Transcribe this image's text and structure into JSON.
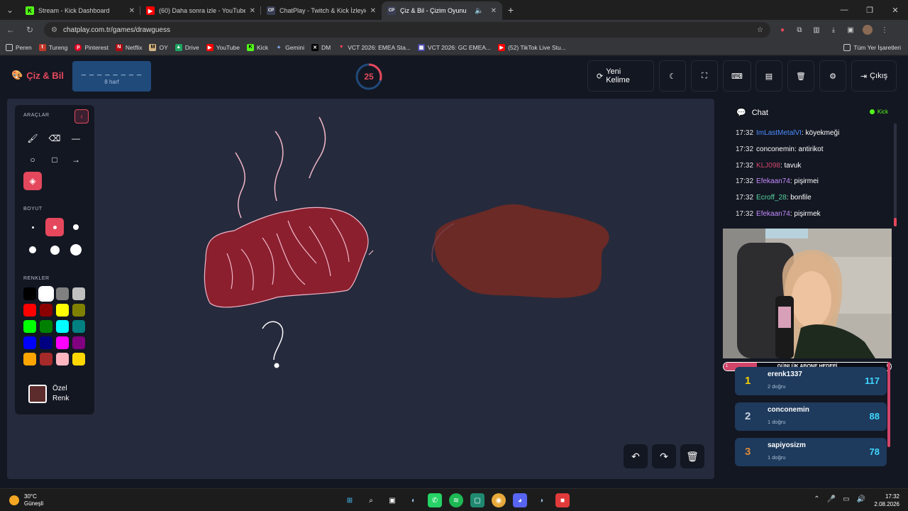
{
  "browser": {
    "tabs": [
      {
        "title": "Stream - Kick Dashboard",
        "fav": "K",
        "color": "#53fc18"
      },
      {
        "title": "(60) Daha sonra izle - YouTube",
        "fav": "▶",
        "color": "#ff0000"
      },
      {
        "title": "ChatPlay - Twitch & Kick İzleyici",
        "fav": "CP",
        "color": "#3a3f55"
      },
      {
        "title": "Çiz & Bil - Çizim Oyunu",
        "fav": "CP",
        "color": "#3a3f55"
      }
    ],
    "url": "chatplay.com.tr/games/drawguess",
    "bookmarks": [
      "Peren",
      "Tureng",
      "Pinterest",
      "Netflix",
      "OY",
      "Drive",
      "YouTube",
      "Kick",
      "Gemini",
      "DM",
      "VCT 2026: EMEA Sta...",
      "VCT 2026: GC EMEA...",
      "(52) TikTok Live Stu..."
    ],
    "bookmarks_right": "Tüm Yer İşaretleri"
  },
  "header": {
    "logo": "Çiz & Bil",
    "word_mask": "_ _ _ _ _ _ _ _",
    "word_length": "8 harf",
    "timer": "25",
    "timer_fraction": 0.3,
    "new_word": "Yeni Kelime",
    "exit": "Çıkış"
  },
  "tools": {
    "title": "ARAÇLAR",
    "size_title": "BOYUT",
    "colors_title": "RENKLER",
    "custom_label_1": "Özel",
    "custom_label_2": "Renk",
    "custom_color": "#5c2b2b",
    "palette": [
      "#000000",
      "#ffffff",
      "#808080",
      "#c0c0c0",
      "#ff0000",
      "#8b0000",
      "#ffff00",
      "#808000",
      "#00ff00",
      "#008000",
      "#00ffff",
      "#008080",
      "#0000ff",
      "#000080",
      "#ff00ff",
      "#800080",
      "#ffa500",
      "#a52a2a",
      "#ffb6c1",
      "#ffd700"
    ]
  },
  "chat": {
    "title": "Chat",
    "platform": "Kick",
    "messages": [
      {
        "time": "17:32",
        "user": "ImLastMetalVI",
        "color": "#4a8cff",
        "text": ": köyekmeği"
      },
      {
        "time": "17:32",
        "user": "conconemin",
        "color": "#ffffff",
        "text": ": antirikot"
      },
      {
        "time": "17:32",
        "user": "KLJ098",
        "color": "#d2456a",
        "text": ": tavuk"
      },
      {
        "time": "17:32",
        "user": "Efekaan74",
        "color": "#c58bff",
        "text": ": pişirmei"
      },
      {
        "time": "17:32",
        "user": "Ecroff_28",
        "color": "#55d6a0",
        "text": ": bonfile"
      },
      {
        "time": "17:32",
        "user": "Efekaan74",
        "color": "#c58bff",
        "text": ": pişirmek"
      }
    ]
  },
  "goal": {
    "label": "GÜNLÜK ABONE HEDEFİ",
    "current": "1",
    "target": "6",
    "progress": 0.2
  },
  "leaderboard": [
    {
      "rank": "1",
      "name": "erenk1337",
      "sub": "2 doğru",
      "score": "117",
      "color": "#f5d000"
    },
    {
      "rank": "2",
      "name": "conconemin",
      "sub": "1 doğru",
      "score": "88",
      "color": "#c9d3e0"
    },
    {
      "rank": "3",
      "name": "sapiyosizm",
      "sub": "1 doğru",
      "score": "78",
      "color": "#d98a3a"
    }
  ],
  "taskbar": {
    "temp": "30°C",
    "weather": "Güneşli",
    "time": "17:32",
    "date": "2.08.2026"
  }
}
